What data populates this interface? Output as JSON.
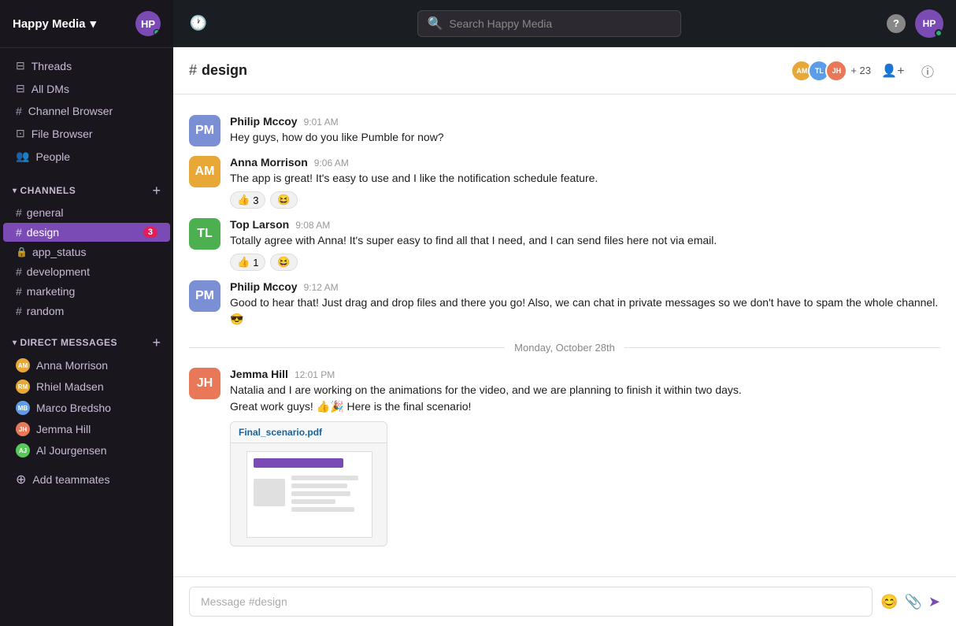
{
  "workspace": {
    "name": "Happy Media",
    "chevron": "▾"
  },
  "topbar": {
    "history_icon": "🕐",
    "search_placeholder": "Search Happy Media",
    "help_icon": "?",
    "avatar_url": ""
  },
  "sidebar": {
    "nav_items": [
      {
        "id": "threads",
        "label": "Threads",
        "icon": "⊟"
      },
      {
        "id": "all-dms",
        "label": "All DMs",
        "icon": "⊟"
      },
      {
        "id": "channel-browser",
        "label": "Channel Browser",
        "icon": "#"
      },
      {
        "id": "file-browser",
        "label": "File Browser",
        "icon": "⊡"
      },
      {
        "id": "people",
        "label": "People",
        "icon": "👥"
      }
    ],
    "channels_section": {
      "label": "CHANNELS",
      "items": [
        {
          "id": "general",
          "label": "general",
          "active": false,
          "locked": false,
          "badge": null
        },
        {
          "id": "design",
          "label": "design",
          "active": true,
          "locked": false,
          "badge": "3"
        },
        {
          "id": "app_status",
          "label": "app_status",
          "active": false,
          "locked": true,
          "badge": null
        },
        {
          "id": "development",
          "label": "development",
          "active": false,
          "locked": false,
          "badge": null
        },
        {
          "id": "marketing",
          "label": "marketing",
          "active": false,
          "locked": false,
          "badge": null
        },
        {
          "id": "random",
          "label": "random",
          "active": false,
          "locked": false,
          "badge": null
        }
      ]
    },
    "dm_section": {
      "label": "DIRECT MESSAGES",
      "items": [
        {
          "id": "anna-morrison",
          "label": "Anna Morrison",
          "color": "#e8a838",
          "initials": "AM"
        },
        {
          "id": "rhiel-madsen",
          "label": "Rhiel Madsen",
          "color": "#e8a838",
          "initials": "RM"
        },
        {
          "id": "marco-bredsho",
          "label": "Marco Bredsho",
          "color": "#5c9ce8",
          "initials": "MB"
        },
        {
          "id": "jemma-hill",
          "label": "Jemma Hill",
          "color": "#e87858",
          "initials": "JH"
        },
        {
          "id": "ai-jourgensen",
          "label": "Al Jourgensen",
          "color": "#58c858",
          "initials": "AJ"
        }
      ]
    },
    "add_teammates_label": "Add teammates"
  },
  "channel": {
    "name": "design",
    "hash": "#",
    "plus_count": "+ 23"
  },
  "messages": [
    {
      "id": "msg1",
      "author": "Philip Mccoy",
      "time": "9:01 AM",
      "text": "Hey guys, how do you like Pumble for now?",
      "reactions": [],
      "initials": "PM",
      "color": "#7b8fd4"
    },
    {
      "id": "msg2",
      "author": "Anna Morrison",
      "time": "9:06 AM",
      "text": "The app is great! It's easy to use and I like the notification schedule feature.",
      "reactions": [
        {
          "emoji": "👍",
          "count": "3"
        },
        {
          "emoji": "😆",
          "count": ""
        }
      ],
      "initials": "AM",
      "color": "#e8a838"
    },
    {
      "id": "msg3",
      "author": "Top Larson",
      "time": "9:08 AM",
      "text": "Totally agree with Anna! It's super easy to find all that I need, and I can send files here not via email.",
      "reactions": [
        {
          "emoji": "👍",
          "count": "1"
        },
        {
          "emoji": "😆",
          "count": ""
        }
      ],
      "initials": "TL",
      "color": "#4caf50"
    },
    {
      "id": "msg4",
      "author": "Philip Mccoy",
      "time": "9:12 AM",
      "text": "Good to hear that! Just drag and drop files and there you go! Also, we can chat in private messages so we don't have to spam the whole channel. 😎",
      "reactions": [],
      "initials": "PM",
      "color": "#7b8fd4"
    }
  ],
  "date_divider": "Monday, October 28th",
  "late_message": {
    "author": "Jemma Hill",
    "time": "12:01 PM",
    "text1": "Natalia and I are working on the animations for the video, and we are planning to finish it within two days.",
    "text2": "Great work guys! 👍🎉  Here is the final scenario!",
    "file_name": "Final_scenario.pdf",
    "initials": "JH",
    "color": "#e87858"
  },
  "message_input": {
    "placeholder": "Message #design"
  },
  "icons": {
    "hash": "#",
    "lock": "🔒",
    "emoji": "😊",
    "attach": "📎",
    "send": "➤",
    "search": "🔍",
    "add": "+",
    "chevron_down": "▾",
    "add_person": "👤",
    "info": "ⓘ"
  }
}
